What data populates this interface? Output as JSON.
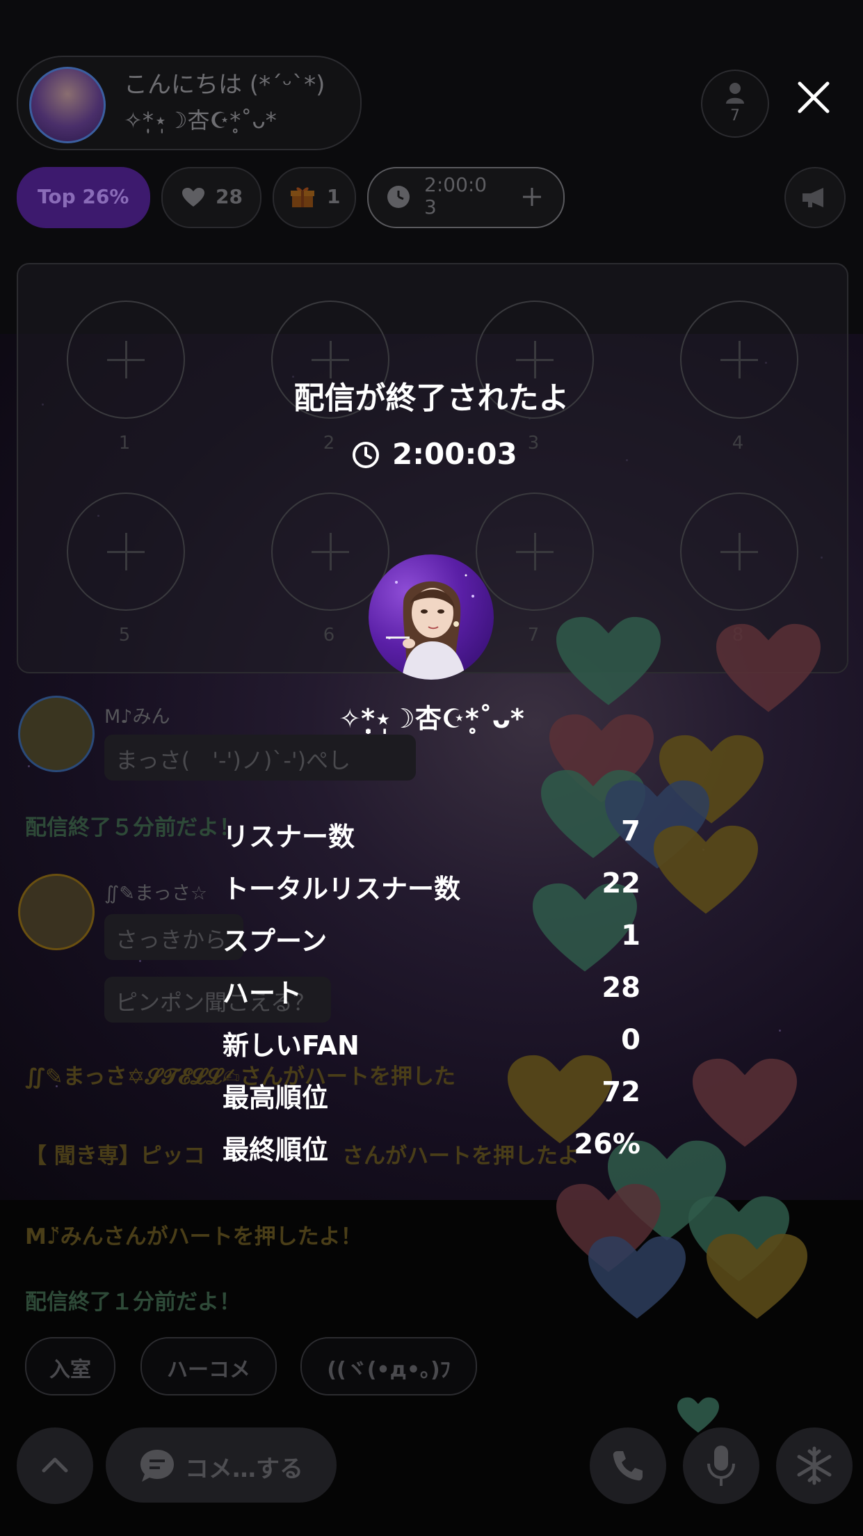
{
  "header": {
    "greeting": "こんにちは (*´ᵕ`*)",
    "host_name": "✧*̣̩⋆̩☽杏☪︎*̥˚ᴗ*",
    "listener_count": "7"
  },
  "chips": {
    "top": "Top 26%",
    "hearts": "28",
    "spoons": "1",
    "timer_line1": "2:00:0",
    "timer_line2": "3"
  },
  "seats": [
    "1",
    "2",
    "3",
    "4",
    "5",
    "6",
    "7",
    "8"
  ],
  "chat": {
    "msg1_name": "M♪みん",
    "msg1_text": "まっさ(　'-')ノ)`-')ぺし",
    "sys1": "配信終了５分前だよ！",
    "msg2_name": "∬✎まっさ☆",
    "msg2_text1": "さっきから",
    "msg2_text2": "ピンポン聞こえる？",
    "sys2": "∬✎まっさ✡𝓢𝓣𝓔𝓛𝓛✍さんがハートを押した",
    "sys3_a": "【 聞き専】ピッコ",
    "sys3_b": "さんがハートを押したよ",
    "sys4": "M♪̈みんさんがハートを押したよ！",
    "sys5": "配信終了１分前だよ！"
  },
  "quick_buttons": [
    "入室",
    "ハーコメ",
    "((ヾ(•д•｡)ﾌ"
  ],
  "bottom_bar": {
    "comment_placeholder": "コメ…する"
  },
  "end_screen": {
    "title": "配信が終了されたよ",
    "duration": "2:00:03",
    "dj_name": "✧*̣̩⋆̩☽杏☪︎*̥˚ᴗ*",
    "stats": [
      {
        "label": "リスナー数",
        "value": "7"
      },
      {
        "label": "トータルリスナー数",
        "value": "22"
      },
      {
        "label": "スプーン",
        "value": "1"
      },
      {
        "label": "ハート",
        "value": "28"
      },
      {
        "label": "新しいFAN",
        "value": "0"
      },
      {
        "label": "最高順位",
        "value": "72"
      },
      {
        "label": "最終順位",
        "value": "26%"
      }
    ]
  },
  "colors": {
    "accent_purple": "#3d1a6e",
    "heart_green": "#2f5a4a",
    "heart_pink": "#5a3036",
    "heart_gold": "#5a4a18",
    "heart_blue": "#2e3e5e"
  }
}
